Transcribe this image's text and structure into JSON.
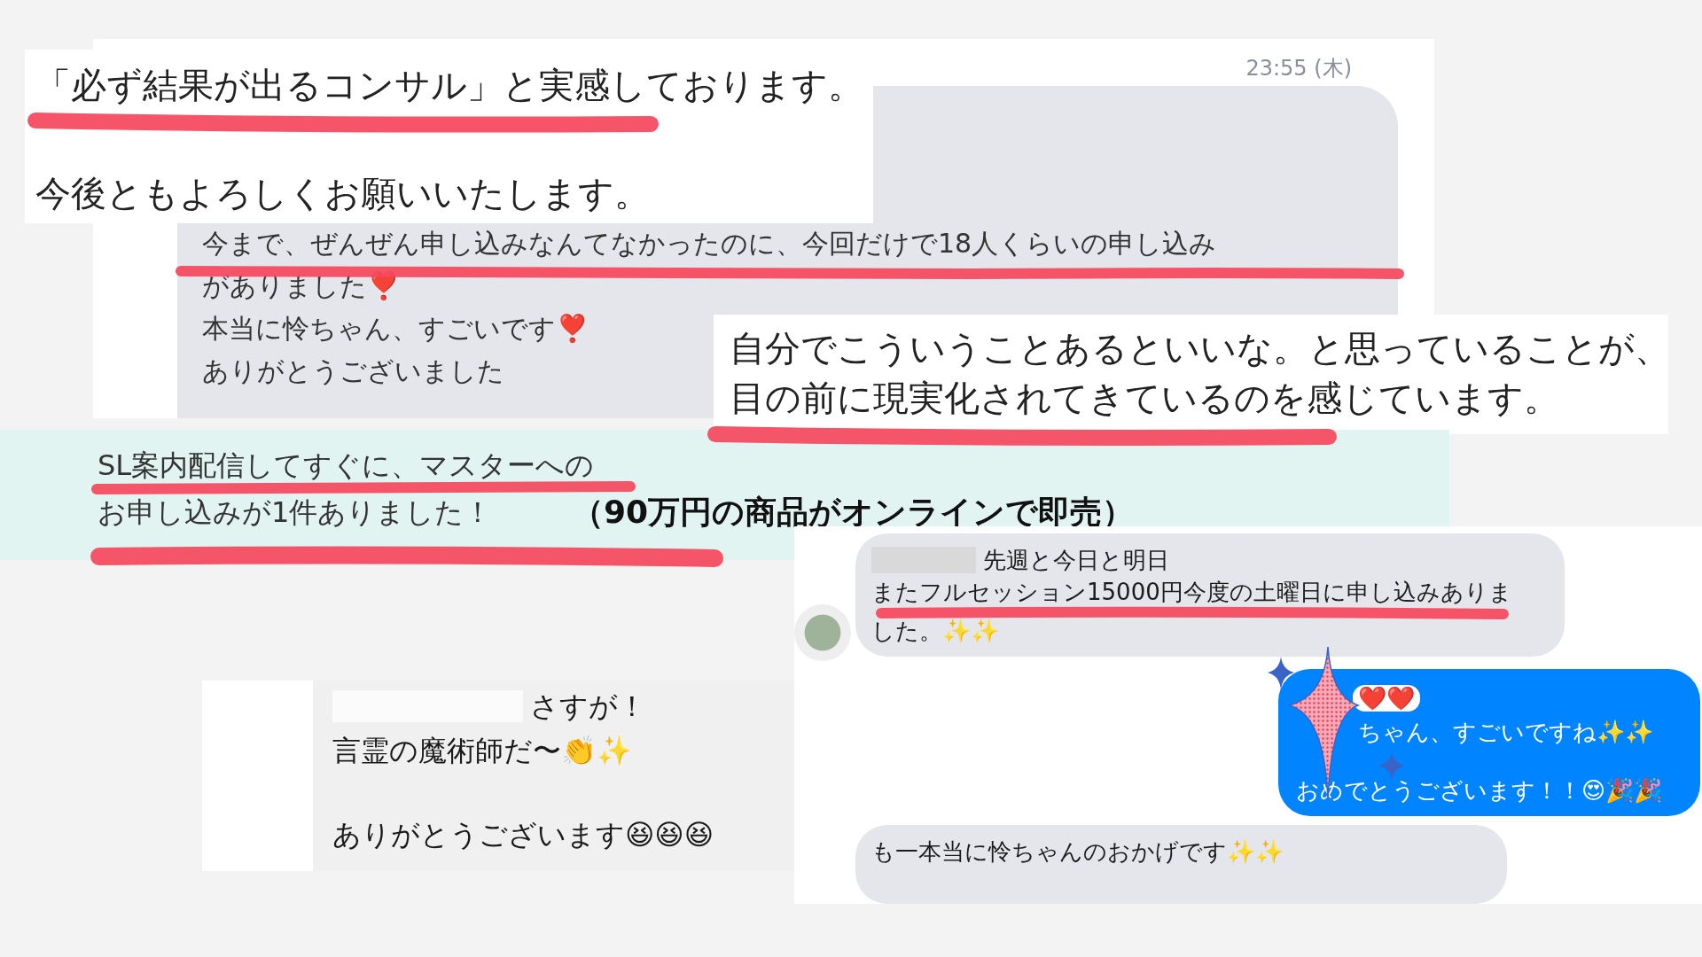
{
  "line_chat": {
    "timestamp": "23:55 (木)",
    "lines": [
      "今まで、ぜんぜん申し込みなんてなかったのに、今回だけで18人くらいの申し込み",
      "がありました❣️",
      "本当に怜ちゃん、すごいです❣️",
      "ありがとうございました"
    ]
  },
  "testimonial_top": {
    "paragraphs": [
      [
        "「必ず結果が出るコンサル」と実感しております。"
      ],
      [
        "今後ともよろしくお願いいたします。"
      ]
    ]
  },
  "testimonial_right": {
    "lines": [
      "自分でこういうことあるといいな。と思っていることが、",
      "目の前に現実化されてきているのを感じています。"
    ]
  },
  "announcement": {
    "lines": [
      "SL案内配信してすぐに、マスターへの",
      "お申し込みが1件ありました！"
    ],
    "caption": "（90万円の商品がオンラインで即売）"
  },
  "messenger": {
    "messages": [
      {
        "kind": "incoming",
        "redacted_start": true,
        "paragraphs": [
          [
            "先週と今日と明日",
            "またフルセッション15000円今度の土曜日に申し込みありま",
            "した。✨✨"
          ]
        ]
      },
      {
        "kind": "outgoing",
        "redacted_start": false,
        "paragraphs": [
          [
            "❤️❤️",
            "ちゃん、すごいですね✨✨"
          ],
          [
            "おめでとうございます！！😍🎉🎉"
          ]
        ]
      },
      {
        "kind": "incoming",
        "redacted_start": false,
        "paragraphs": [
          [
            "も一本当に怜ちゃんのおかげです✨✨"
          ]
        ]
      }
    ]
  },
  "reply": {
    "redacted_start": true,
    "paragraphs": [
      [
        "さすが！",
        "言霊の魔術師だ〜👏✨"
      ],
      [
        "ありがとうございます😆😆😆"
      ]
    ]
  }
}
